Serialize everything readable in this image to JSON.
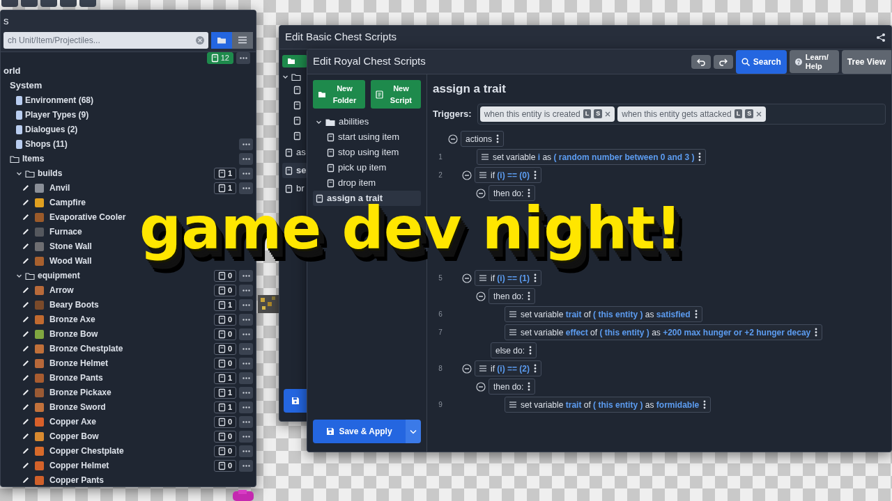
{
  "entity_panel": {
    "title": "s",
    "search": {
      "placeholder": "ch Unit/Item/Projectiles..."
    },
    "script_count": "12",
    "tree": [
      {
        "label": "orld",
        "kind": "section",
        "children": [
          {
            "label": "System",
            "kind": "section",
            "children": [
              {
                "label": "Environment (68)",
                "kind": "category",
                "menu": false
              },
              {
                "label": "Player Types (9)",
                "kind": "category",
                "menu": false
              },
              {
                "label": "Dialogues (2)",
                "kind": "category",
                "menu": false
              },
              {
                "label": "Shops (11)",
                "kind": "category",
                "menu": true
              }
            ]
          },
          {
            "label": "Items",
            "kind": "folder",
            "menu": true,
            "children": [
              {
                "label": "builds",
                "kind": "folder",
                "expanded": true,
                "scripts": "1",
                "menu": true,
                "children": [
                  {
                    "label": "Anvil",
                    "kind": "entity",
                    "color": "#8a8f98",
                    "scripts": "1",
                    "menu": true
                  },
                  {
                    "label": "Campfire",
                    "kind": "entity",
                    "color": "#e0a020",
                    "menu": false
                  },
                  {
                    "label": "Evaporative Cooler",
                    "kind": "entity",
                    "color": "#9a5a2a",
                    "menu": false
                  },
                  {
                    "label": "Furnace",
                    "kind": "entity",
                    "color": "#55585e",
                    "menu": false
                  },
                  {
                    "label": "Stone Wall",
                    "kind": "entity",
                    "color": "#6e6e72",
                    "menu": false
                  },
                  {
                    "label": "Wood Wall",
                    "kind": "entity",
                    "color": "#a8602e",
                    "menu": false
                  }
                ]
              },
              {
                "label": "equipment",
                "kind": "folder",
                "expanded": true,
                "scripts": "0",
                "menu": true,
                "children": [
                  {
                    "label": "Arrow",
                    "kind": "entity",
                    "color": "#b86a3a",
                    "scripts": "0",
                    "menu": true
                  },
                  {
                    "label": "Beary Boots",
                    "kind": "entity",
                    "color": "#7a4a2a",
                    "scripts": "1",
                    "menu": true
                  },
                  {
                    "label": "Bronze Axe",
                    "kind": "entity",
                    "color": "#c06a30",
                    "scripts": "0",
                    "menu": true
                  },
                  {
                    "label": "Bronze Bow",
                    "kind": "entity",
                    "color": "#7fa640",
                    "scripts": "0",
                    "menu": true
                  },
                  {
                    "label": "Bronze Chestplate",
                    "kind": "entity",
                    "color": "#c0703a",
                    "scripts": "0",
                    "menu": true
                  },
                  {
                    "label": "Bronze Helmet",
                    "kind": "entity",
                    "color": "#b8683a",
                    "scripts": "0",
                    "menu": true
                  },
                  {
                    "label": "Bronze Pants",
                    "kind": "entity",
                    "color": "#a85c30",
                    "scripts": "1",
                    "menu": true
                  },
                  {
                    "label": "Bronze Pickaxe",
                    "kind": "entity",
                    "color": "#9a5a34",
                    "scripts": "1",
                    "menu": true
                  },
                  {
                    "label": "Bronze Sword",
                    "kind": "entity",
                    "color": "#c2723c",
                    "scripts": "1",
                    "menu": true
                  },
                  {
                    "label": "Copper Axe",
                    "kind": "entity",
                    "color": "#d8602a",
                    "scripts": "0",
                    "menu": true
                  },
                  {
                    "label": "Copper Bow",
                    "kind": "entity",
                    "color": "#d88a30",
                    "scripts": "0",
                    "menu": true
                  },
                  {
                    "label": "Copper Chestplate",
                    "kind": "entity",
                    "color": "#d86a2a",
                    "scripts": "0",
                    "menu": true
                  },
                  {
                    "label": "Copper Helmet",
                    "kind": "entity",
                    "color": "#d4622a",
                    "scripts": "0",
                    "menu": true
                  },
                  {
                    "label": "Copper Pants",
                    "kind": "entity",
                    "color": "#d0602a",
                    "menu": false
                  }
                ]
              }
            ]
          }
        ]
      }
    ]
  },
  "basic_window": {
    "title": "Edit Basic Chest Scripts",
    "scripts": [
      {
        "label": "as",
        "selected": false
      },
      {
        "label": "se",
        "selected": true
      },
      {
        "label": "br",
        "selected": false
      }
    ]
  },
  "royal_window": {
    "title": "Edit Royal Chest Scripts",
    "toolbar": {
      "search": "Search",
      "help": "Learn/ Help",
      "tree_view": "Tree View"
    },
    "new_folder": "New Folder",
    "new_script": "New Script",
    "scripts": [
      {
        "label": "abilities",
        "kind": "folder",
        "expanded": true,
        "selected": false,
        "children": [
          {
            "label": "start using item",
            "kind": "script",
            "selected": false
          },
          {
            "label": "stop using item",
            "kind": "script",
            "selected": false
          },
          {
            "label": "pick up item",
            "kind": "script",
            "selected": false
          },
          {
            "label": "drop item",
            "kind": "script",
            "selected": false
          }
        ]
      },
      {
        "label": "assign a trait",
        "kind": "script",
        "selected": true
      }
    ],
    "save": "Save & Apply",
    "script_title": "assign a trait",
    "triggers_label": "Triggers:",
    "triggers": [
      {
        "label": "when this entity is created",
        "tags": [
          "L",
          "S"
        ]
      },
      {
        "label": "when this entity gets attacked",
        "tags": [
          "L",
          "S"
        ]
      }
    ],
    "actions": {
      "label": "actions",
      "kind": "branch",
      "expanded": true,
      "children": [
        {
          "line": "1",
          "kind": "statement",
          "parts": [
            {
              "text": "set variable",
              "kind": "plain"
            },
            {
              "text": "i",
              "kind": "value"
            },
            {
              "text": "as",
              "kind": "plain"
            },
            {
              "text": "( random number between 0 and 3 )",
              "kind": "value"
            }
          ]
        },
        {
          "line": "2",
          "kind": "statement",
          "expanded": true,
          "parts": [
            {
              "text": "if",
              "kind": "plain"
            },
            {
              "text": "(i) == (0)",
              "kind": "value"
            }
          ],
          "children": [
            {
              "label": "then do:",
              "kind": "branch",
              "expanded": true
            }
          ]
        },
        {
          "line": "5",
          "kind": "statement",
          "expanded": true,
          "parts": [
            {
              "text": "if",
              "kind": "plain"
            },
            {
              "text": "(i) == (1)",
              "kind": "value"
            }
          ],
          "children": [
            {
              "label": "then do:",
              "kind": "branch",
              "expanded": true,
              "children": [
                {
                  "line": "6",
                  "kind": "statement",
                  "parts": [
                    {
                      "text": "set variable",
                      "kind": "plain"
                    },
                    {
                      "text": "trait",
                      "kind": "value"
                    },
                    {
                      "text": "of",
                      "kind": "plain"
                    },
                    {
                      "text": "( this entity )",
                      "kind": "value"
                    },
                    {
                      "text": "as",
                      "kind": "plain"
                    },
                    {
                      "text": "satisfied",
                      "kind": "value"
                    }
                  ]
                },
                {
                  "line": "7",
                  "kind": "statement",
                  "parts": [
                    {
                      "text": "set variable",
                      "kind": "plain"
                    },
                    {
                      "text": "effect",
                      "kind": "value"
                    },
                    {
                      "text": "of",
                      "kind": "plain"
                    },
                    {
                      "text": "( this entity )",
                      "kind": "value"
                    },
                    {
                      "text": "as",
                      "kind": "plain"
                    },
                    {
                      "text": "+200 max hunger or +2 hunger decay",
                      "kind": "value"
                    }
                  ]
                }
              ]
            },
            {
              "label": "else do:",
              "kind": "branch"
            }
          ]
        },
        {
          "line": "8",
          "kind": "statement",
          "expanded": true,
          "parts": [
            {
              "text": "if",
              "kind": "plain"
            },
            {
              "text": "(i) == (2)",
              "kind": "value"
            }
          ],
          "children": [
            {
              "label": "then do:",
              "kind": "branch",
              "expanded": true,
              "children": [
                {
                  "line": "9",
                  "kind": "statement",
                  "parts": [
                    {
                      "text": "set variable",
                      "kind": "plain"
                    },
                    {
                      "text": "trait",
                      "kind": "value"
                    },
                    {
                      "text": "of",
                      "kind": "plain"
                    },
                    {
                      "text": "( this entity )",
                      "kind": "value"
                    },
                    {
                      "text": "as",
                      "kind": "plain"
                    },
                    {
                      "text": "formidable",
                      "kind": "value"
                    }
                  ]
                }
              ]
            }
          ]
        }
      ]
    }
  },
  "headline": "game dev night!"
}
